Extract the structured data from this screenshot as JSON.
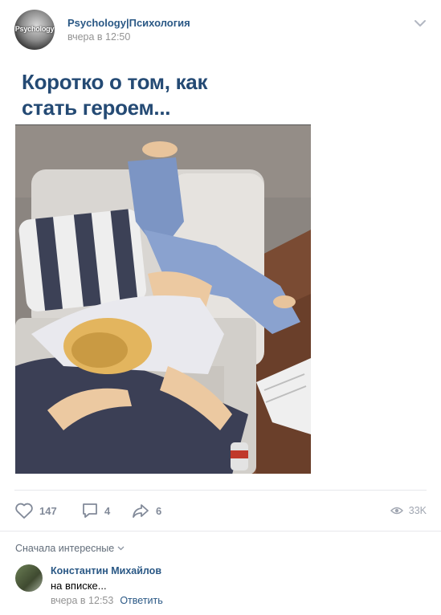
{
  "post": {
    "author": "Psychology|Психология",
    "avatar_text": "Psychology",
    "timestamp": "вчера в 12:50",
    "title_line1": "Коротко о том, как",
    "title_line2": "стать героем..."
  },
  "actions": {
    "likes": "147",
    "comments": "4",
    "shares": "6",
    "views": "33K"
  },
  "comments_section": {
    "sort_label": "Сначала интересные",
    "items": [
      {
        "author": "Константин Михайлов",
        "text": "на вписке...",
        "timestamp": "вчера в 12:53",
        "reply_label": "Ответить"
      }
    ]
  },
  "colors": {
    "link": "#2a5885",
    "title": "#244a74",
    "muted": "#939393",
    "icon": "#828a99"
  },
  "icons": [
    "chevron-down-icon",
    "heart-icon",
    "comment-icon",
    "share-icon",
    "eye-icon"
  ]
}
